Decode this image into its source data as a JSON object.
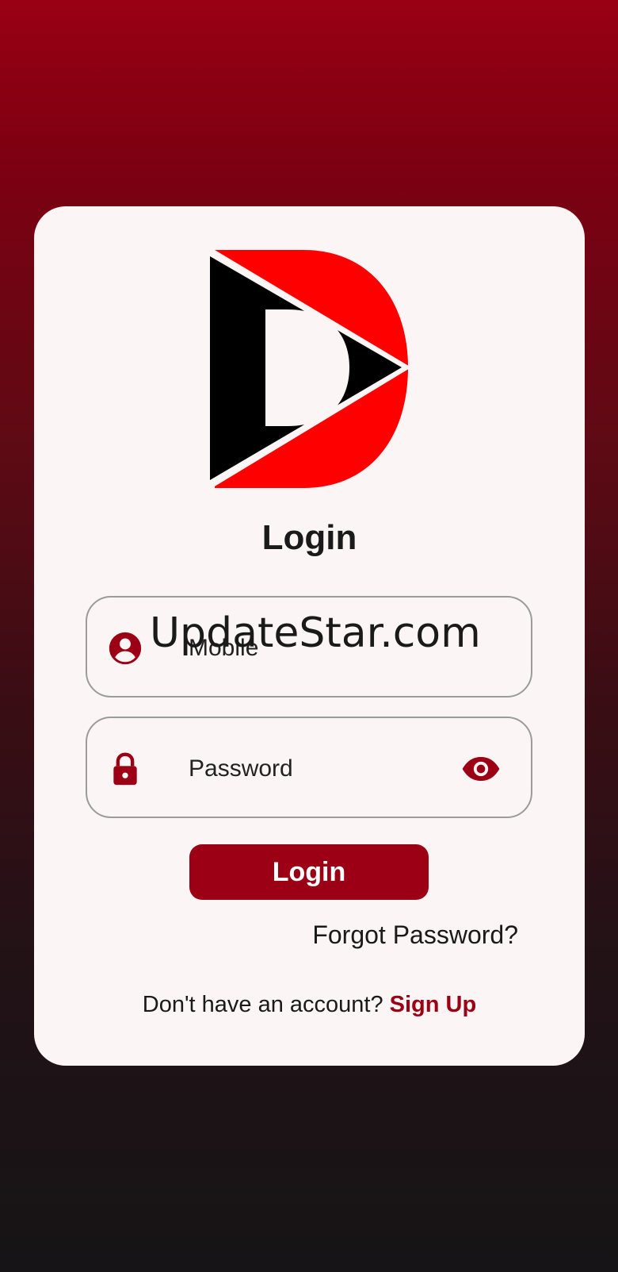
{
  "login": {
    "title": "Login",
    "mobile_placeholder": "Mobile",
    "password_placeholder": "Password",
    "login_button": "Login",
    "forgot_password": "Forgot Password?",
    "no_account_text": "Don't have an account?",
    "signup_link": "Sign Up"
  },
  "watermark": "UpdateStar.com",
  "icons": {
    "logo": "d-play-logo",
    "mobile": "user-circle-icon",
    "password": "lock-icon",
    "visibility": "eye-icon"
  },
  "colors": {
    "brand": "#9c0014",
    "logo_red": "#ff0000",
    "logo_black": "#000000",
    "card": "#fbf5f5"
  }
}
